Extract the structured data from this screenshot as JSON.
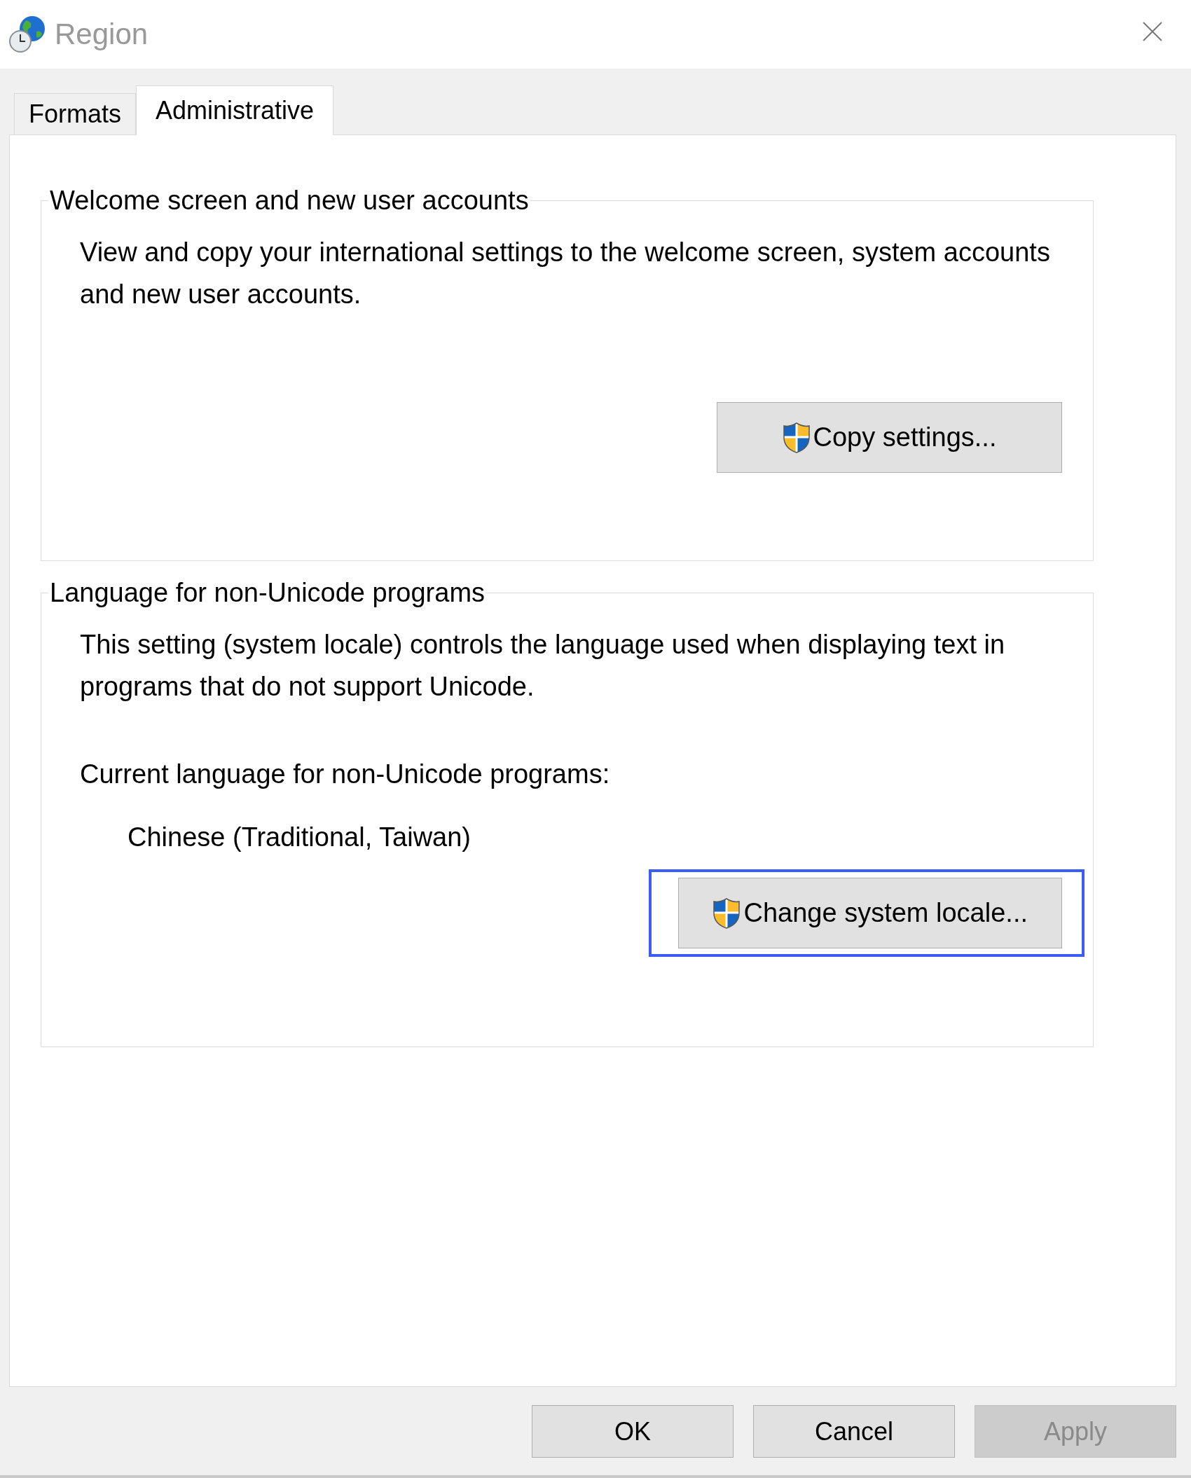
{
  "window": {
    "title": "Region"
  },
  "tabs": [
    {
      "label": "Formats",
      "selected": false
    },
    {
      "label": "Administrative",
      "selected": true
    }
  ],
  "groups": [
    {
      "title": "Welcome screen and new user accounts",
      "items": [
        {
          "kind": "description",
          "text": "View and copy your international settings to the welcome screen, system accounts and new user accounts."
        }
      ],
      "button": {
        "label": "Copy settings...",
        "focused": false
      }
    },
    {
      "title": "Language for non-Unicode programs",
      "items": [
        {
          "kind": "description",
          "text": "This setting (system locale) controls the language used when displaying text in programs that do not support Unicode."
        },
        {
          "kind": "label",
          "text": "Current language for non-Unicode programs:"
        },
        {
          "kind": "value",
          "text": "Chinese (Traditional, Taiwan)"
        }
      ],
      "button": {
        "label": "Change system locale...",
        "focused": true
      }
    }
  ],
  "buttons": [
    {
      "label": "OK",
      "disabled": false
    },
    {
      "label": "Cancel",
      "disabled": false
    },
    {
      "label": "Apply",
      "disabled": true
    }
  ]
}
